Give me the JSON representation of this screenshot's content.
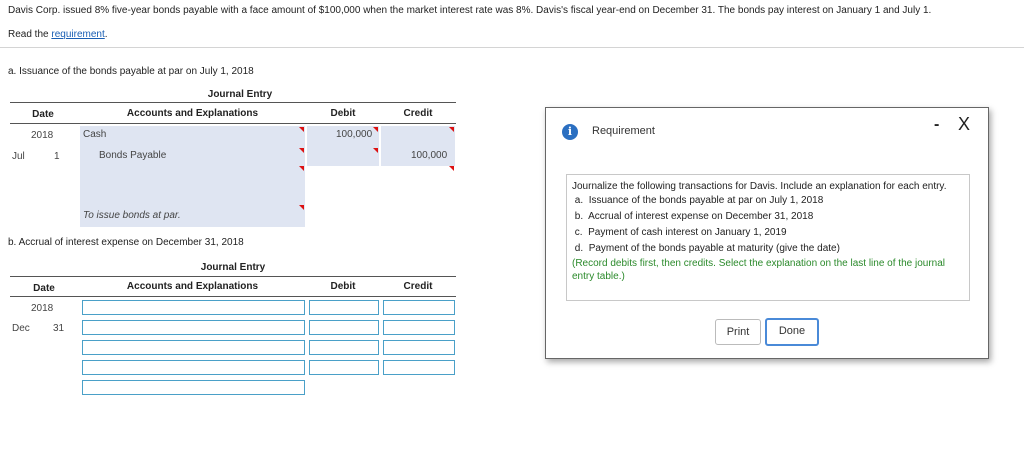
{
  "problem": "Davis Corp. issued 8% five-year bonds payable with a face amount of $100,000 when the market interest rate was 8%. Davis's fiscal year-end on December 31. The bonds pay interest on January 1 and July 1.",
  "read_prefix": "Read the ",
  "read_link": "requirement",
  "read_suffix": ".",
  "part_a": {
    "label": "a. Issuance of the bonds payable at par on July 1, 2018",
    "journal_title": "Journal Entry",
    "headers": {
      "date": "Date",
      "accounts": "Accounts and Explanations",
      "debit": "Debit",
      "credit": "Credit"
    },
    "year": "2018",
    "month": "Jul",
    "day": "1",
    "row1": {
      "account": "Cash",
      "debit": "100,000"
    },
    "row2": {
      "account": "Bonds Payable",
      "credit": "100,000"
    },
    "explanation": "To issue bonds at par."
  },
  "part_b": {
    "label": "b. Accrual of interest expense on December 31, 2018",
    "journal_title": "Journal Entry",
    "headers": {
      "date": "Date",
      "accounts": "Accounts and Explanations",
      "debit": "Debit",
      "credit": "Credit"
    },
    "year": "2018",
    "month": "Dec",
    "day": "31"
  },
  "modal": {
    "title": "Requirement",
    "info_icon": "i",
    "minimize": "-",
    "close": "X",
    "intro": "Journalize the following transactions for Davis. Include an explanation for each entry.",
    "items": [
      {
        "letter": "a.",
        "text": "Issuance of the bonds payable at par on July 1, 2018"
      },
      {
        "letter": "b.",
        "text": "Accrual of interest expense on December 31, 2018"
      },
      {
        "letter": "c.",
        "text": "Payment of cash interest on January 1, 2019"
      },
      {
        "letter": "d.",
        "text": "Payment of the bonds payable at maturity (give the date)"
      }
    ],
    "note": "(Record debits first, then credits. Select the explanation on the last line of the journal entry table.)",
    "print_label": "Print",
    "done_label": "Done"
  }
}
